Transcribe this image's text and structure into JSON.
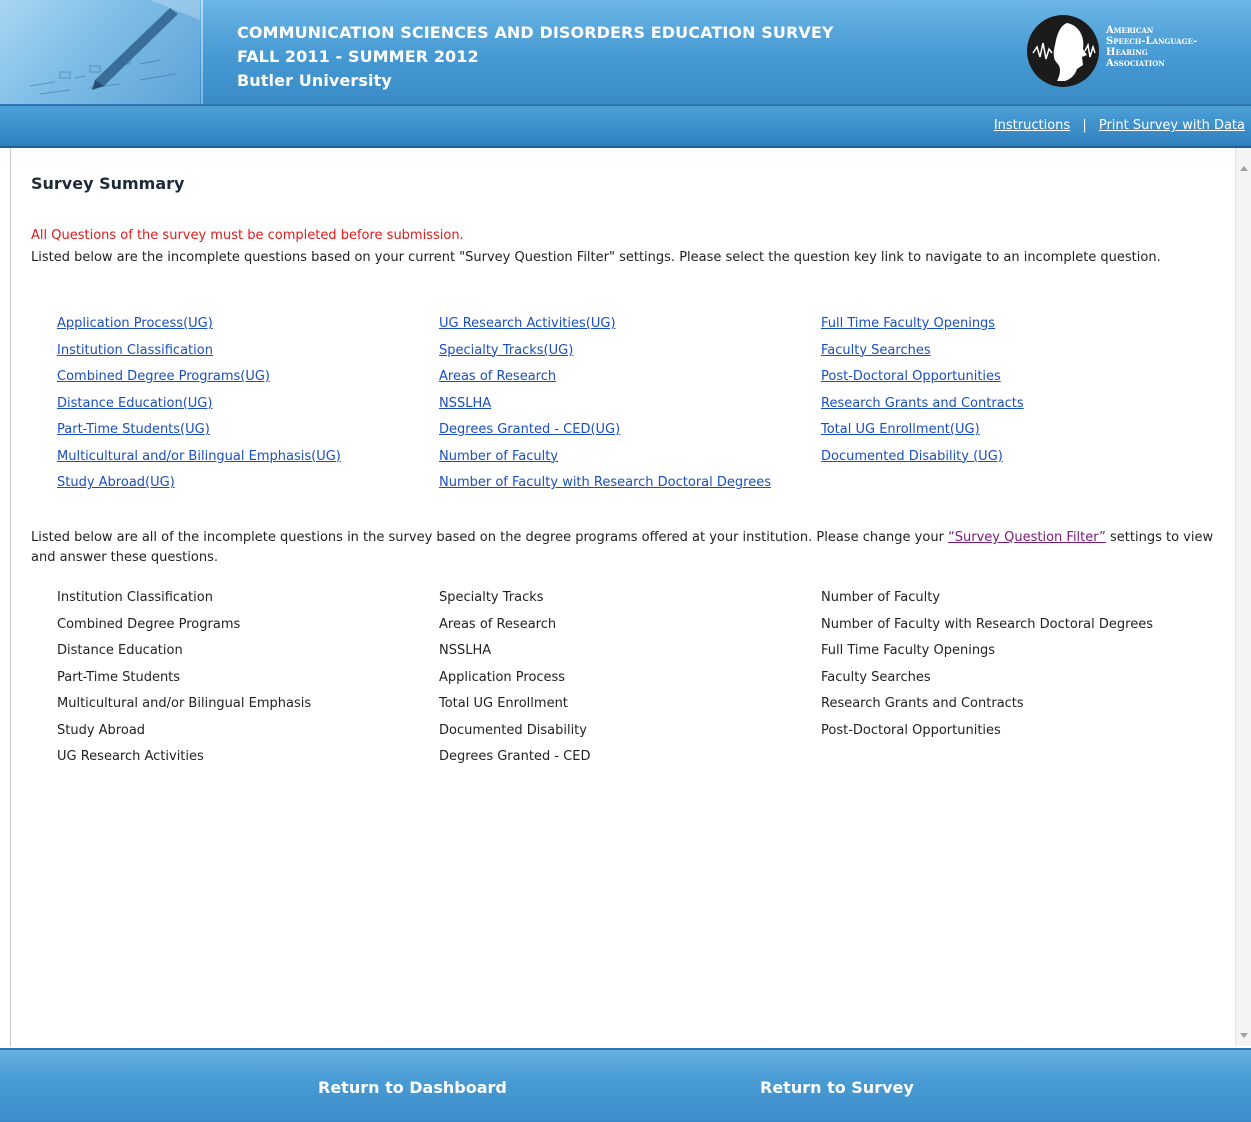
{
  "header": {
    "title_line1": "COMMUNICATION SCIENCES AND DISORDERS EDUCATION SURVEY",
    "title_line2": "FALL 2011 - SUMMER 2012",
    "title_line3": "Butler University",
    "logo": {
      "line1": "American",
      "line2": "Speech-Language-",
      "line3": "Hearing",
      "line4": "Association",
      "icon": "asha-profile-logo-icon"
    },
    "photo_icon": "pen-and-form-photo"
  },
  "nav": {
    "instructions": "Instructions",
    "separator": "|",
    "print": "Print Survey with Data"
  },
  "main": {
    "title": "Survey Summary",
    "alert": "All Questions of the survey must be completed before submission.",
    "intro": "Listed below are the incomplete questions based on your current \"Survey Question Filter\" settings. Please select the question key link to navigate to an incomplete question.",
    "link_columns": [
      [
        "Application Process(UG)",
        "Institution Classification",
        "Combined Degree Programs(UG)",
        "Distance Education(UG)",
        "Part-Time Students(UG)",
        "Multicultural and/or Bilingual Emphasis(UG)",
        "Study Abroad(UG)"
      ],
      [
        "UG Research Activities(UG)",
        "Specialty Tracks(UG)",
        "Areas of Research",
        "NSSLHA",
        "Degrees Granted - CED(UG)",
        "Number of Faculty",
        "Number of Faculty with Research Doctoral Degrees"
      ],
      [
        "Full Time Faculty Openings",
        "Faculty Searches",
        "Post-Doctoral Opportunities",
        "Research Grants and Contracts",
        "Total UG Enrollment(UG)",
        "Documented Disability (UG)"
      ]
    ],
    "second_intro_prefix": "Listed below are all of the incomplete questions in the survey based on the degree programs offered at your institution. Please change your ",
    "second_intro_link": "“Survey Question Filter”",
    "second_intro_suffix": " settings to view and answer these questions.",
    "text_columns": [
      [
        "Institution Classification",
        "Combined Degree Programs",
        "Distance Education",
        "Part-Time Students",
        "Multicultural and/or Bilingual Emphasis",
        "Study Abroad",
        "UG Research Activities"
      ],
      [
        "Specialty Tracks",
        "Areas of Research",
        "NSSLHA",
        "Application Process",
        "Total UG Enrollment",
        "Documented Disability",
        "Degrees Granted - CED"
      ],
      [
        "Number of Faculty",
        "Number of Faculty with Research Doctoral Degrees",
        "Full Time Faculty Openings",
        "Faculty Searches",
        "Research Grants and Contracts",
        "Post-Doctoral Opportunities"
      ]
    ]
  },
  "footer": {
    "dashboard": "Return to Dashboard",
    "survey": "Return to Survey"
  },
  "colors": {
    "header_blue": "#4699d2",
    "nav_blue": "#3b8dc8",
    "alert_red": "#e11a1a",
    "link_blue": "#1a4fbf",
    "visited_link": "#7a1a7a"
  }
}
